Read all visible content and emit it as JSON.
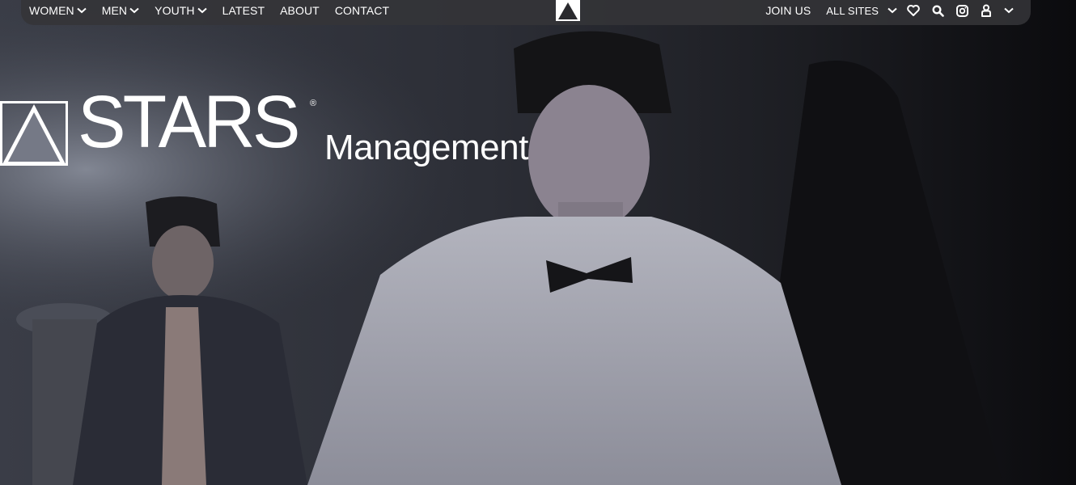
{
  "nav": {
    "left": [
      {
        "label": "WOMEN",
        "dropdown": true
      },
      {
        "label": "MEN",
        "dropdown": true
      },
      {
        "label": "YOUTH",
        "dropdown": true
      },
      {
        "label": "LATEST",
        "dropdown": false
      },
      {
        "label": "ABOUT",
        "dropdown": false
      },
      {
        "label": "CONTACT",
        "dropdown": false
      }
    ],
    "join_label": "JOIN US",
    "all_sites_label": "ALL SITES",
    "icons": [
      "chevron-down-icon",
      "heart-icon",
      "search-icon",
      "instagram-icon",
      "user-icon",
      "chevron-down-icon"
    ]
  },
  "brand": {
    "name": "STARS",
    "registered": "®",
    "subtitle": "Management"
  },
  "colors": {
    "nav_bg": "#343438",
    "text": "#ffffff"
  }
}
